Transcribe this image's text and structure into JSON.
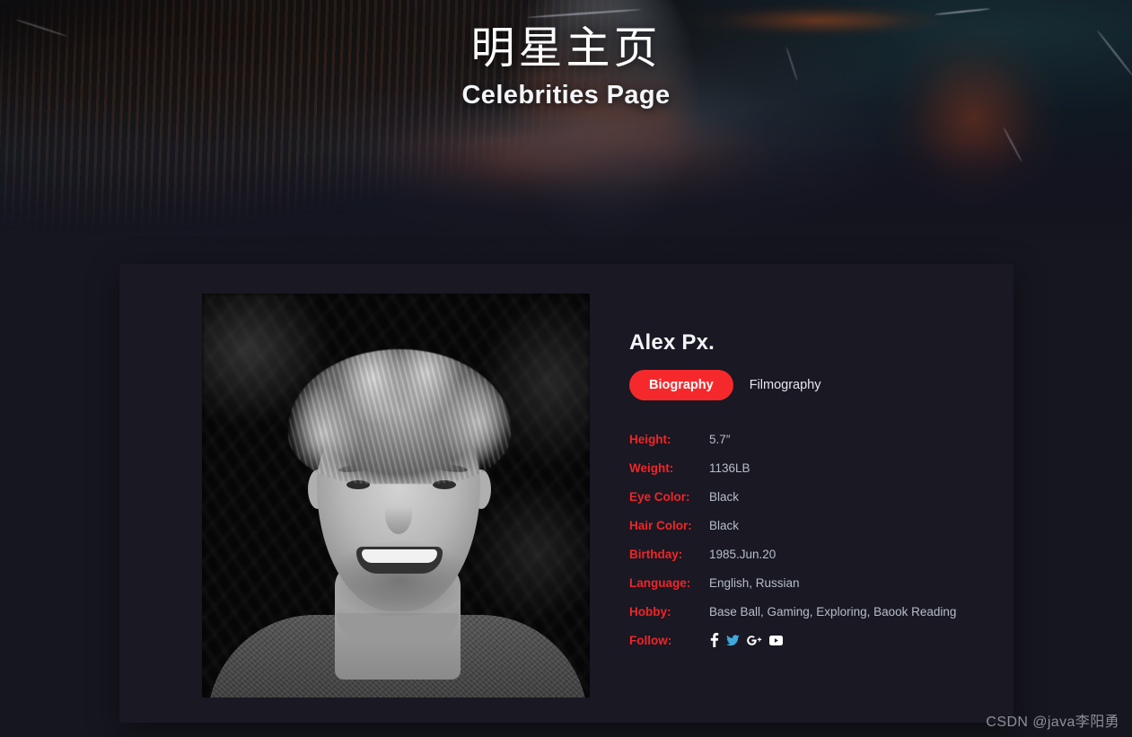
{
  "hero": {
    "title_cn": "明星主页",
    "title_en": "Celebrities Page"
  },
  "card": {
    "portrait_alt": "celebrity-portrait",
    "name": "Alex Px.",
    "tabs": [
      {
        "label": "Biography",
        "active": true
      },
      {
        "label": "Filmography",
        "active": false
      }
    ],
    "details": [
      {
        "label": "Height:",
        "value": "5.7″"
      },
      {
        "label": "Weight:",
        "value": "1136LB"
      },
      {
        "label": "Eye Color:",
        "value": "Black"
      },
      {
        "label": "Hair Color:",
        "value": "Black"
      },
      {
        "label": "Birthday:",
        "value": "1985.Jun.20"
      },
      {
        "label": "Language:",
        "value": "English, Russian"
      },
      {
        "label": "Hobby:",
        "value": "Base Ball, Gaming, Exploring, Baook Reading"
      }
    ],
    "follow": {
      "label": "Follow:",
      "icons": [
        {
          "name": "facebook-icon",
          "glyph": "f"
        },
        {
          "name": "twitter-icon",
          "glyph": "bird"
        },
        {
          "name": "googleplus-icon",
          "glyph": "G+"
        },
        {
          "name": "youtube-icon",
          "glyph": "play"
        }
      ]
    }
  },
  "watermark": "CSDN @java李阳勇",
  "colors": {
    "accent_red": "#f5292b",
    "label_red": "#f02527",
    "page_bg": "#16161f",
    "card_bg": "#191823",
    "value_text": "#b6bec9"
  }
}
